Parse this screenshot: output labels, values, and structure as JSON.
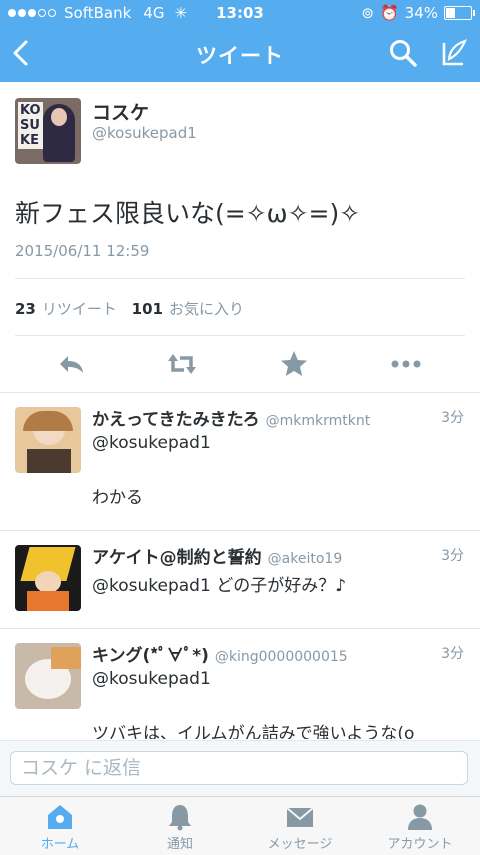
{
  "status_bar": {
    "carrier": "SoftBank",
    "network": "4G",
    "time": "13:03",
    "battery": "34%",
    "battery_level": 0.34
  },
  "nav": {
    "title": "ツイート",
    "back_icon": "chevron-left-icon",
    "search_icon": "search-icon",
    "compose_icon": "compose-icon"
  },
  "tweet": {
    "author_name": "コスケ",
    "author_handle": "@kosukepad1",
    "avatar_letters": [
      "KO",
      "SU",
      "KE"
    ],
    "text": "新フェス限良いな(=✧ω✧=)✧",
    "date": "2015/06/11 12:59",
    "retweet_count": "23",
    "retweet_label": "リツイート",
    "favorite_count": "101",
    "favorite_label": "お気に入り",
    "actions": [
      "reply-icon",
      "retweet-icon",
      "favorite-star-icon",
      "more-icon"
    ]
  },
  "replies": [
    {
      "name": "かえってきたみきたろ",
      "handle": "@mkmkrmtknt",
      "time": "3分",
      "mention": "@kosukepad1",
      "body": "わかる"
    },
    {
      "name": "アケイト@制約と誓約",
      "handle": "@akeito19",
      "time": "3分",
      "mention": "@kosukepad1 どの子が好み？♪",
      "body": ""
    },
    {
      "name": "キング(*ﾟ∀ﾟ*)",
      "handle": "@king0000000015",
      "time": "3分",
      "mention": "@kosukepad1",
      "body": "ツバキは、イルムがん詰みで強いような(o"
    }
  ],
  "reply_input": {
    "placeholder": "コスケ に返信"
  },
  "tabs": [
    {
      "label": "ホーム",
      "icon": "home-icon",
      "active": true
    },
    {
      "label": "通知",
      "icon": "bell-icon",
      "active": false
    },
    {
      "label": "メッセージ",
      "icon": "envelope-icon",
      "active": false
    },
    {
      "label": "アカウント",
      "icon": "person-icon",
      "active": false
    }
  ],
  "colors": {
    "brand": "#55acee",
    "text": "#292f33",
    "muted": "#8899a6"
  }
}
